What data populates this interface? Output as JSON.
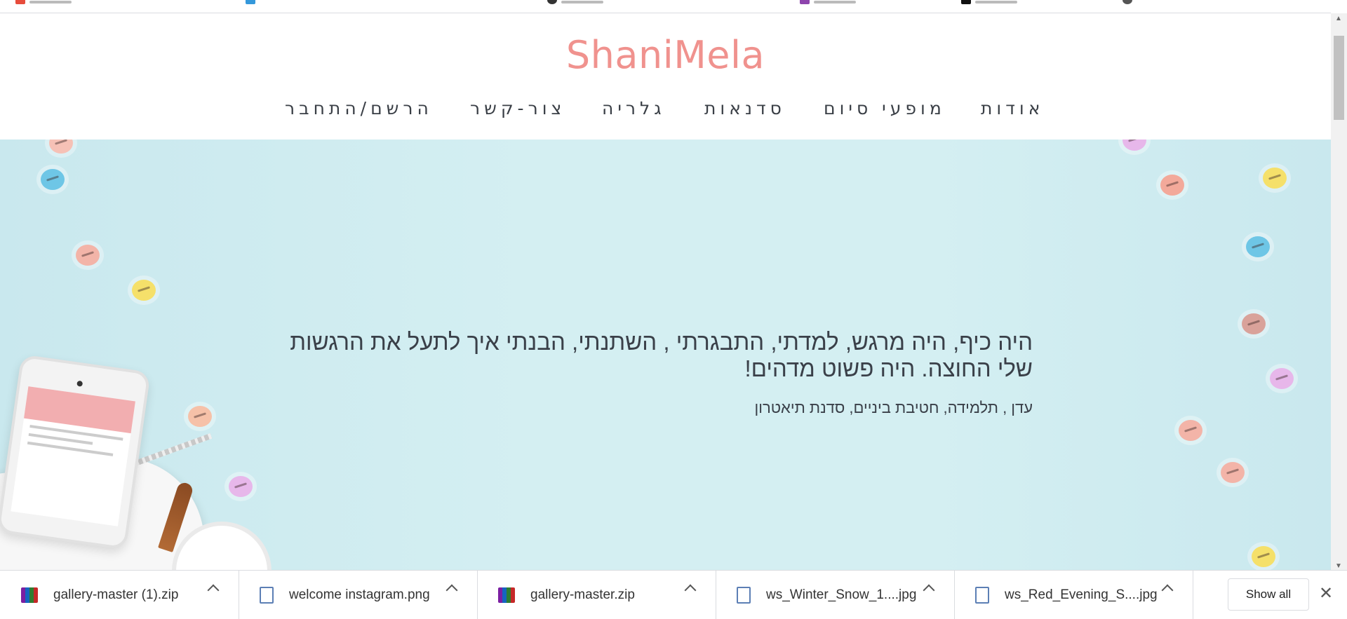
{
  "site": {
    "logo": "ShaniMela",
    "nav": [
      {
        "label": "הרשם/התחבר",
        "name": "nav-register"
      },
      {
        "label": "צור-קשר",
        "name": "nav-contact"
      },
      {
        "label": "גלריה",
        "name": "nav-gallery"
      },
      {
        "label": "סדנאות",
        "name": "nav-workshops"
      },
      {
        "label": "מופעי סיום",
        "name": "nav-shows"
      },
      {
        "label": "אודות",
        "name": "nav-about"
      }
    ]
  },
  "hero": {
    "quote": "היה כיף, היה מרגש, למדתי, התבגרתי , השתנתי, הבנתי איך לתעל את הרגשות שלי החוצה. היה פשוט מדהים!",
    "author": "עדן , תלמידה, חטיבת ביניים, סדנת תיאטרון"
  },
  "downloads": [
    {
      "name": "gallery-master (1).zip",
      "icon": "zip-icon"
    },
    {
      "name": "welcome instagram.png",
      "icon": "image-icon"
    },
    {
      "name": "gallery-master.zip",
      "icon": "zip-icon"
    },
    {
      "name": "ws_Winter_Snow_1....jpg",
      "icon": "image-icon"
    },
    {
      "name": "ws_Red_Evening_S....jpg",
      "icon": "image-icon"
    }
  ],
  "shelf": {
    "show_all": "Show all",
    "close": "✕"
  },
  "colors": {
    "logo": "#f0928e",
    "hero_bg": "#cdebef",
    "nav_text": "#3a3f46"
  }
}
